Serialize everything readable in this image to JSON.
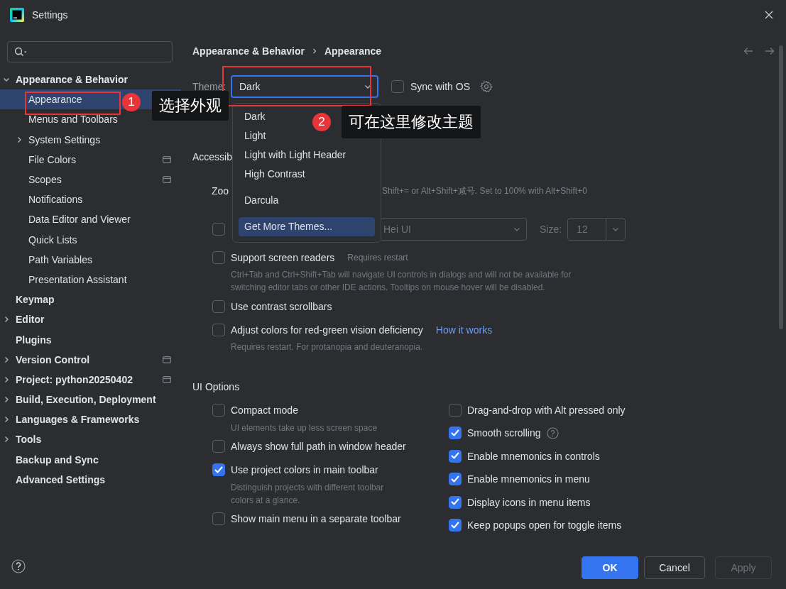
{
  "window": {
    "title": "Settings"
  },
  "sidebar": {
    "items": [
      {
        "label": "Appearance & Behavior",
        "kind": "group",
        "selected": false,
        "expanded": true,
        "project_scoped": false,
        "children": [
          {
            "label": "Appearance",
            "kind": "page",
            "selected": true,
            "project_scoped": false
          },
          {
            "label": "Menus and Toolbars",
            "kind": "page",
            "selected": false,
            "project_scoped": false
          },
          {
            "label": "System Settings",
            "kind": "group",
            "selected": false,
            "expanded": false,
            "project_scoped": false
          },
          {
            "label": "File Colors",
            "kind": "page",
            "selected": false,
            "project_scoped": true
          },
          {
            "label": "Scopes",
            "kind": "page",
            "selected": false,
            "project_scoped": true
          },
          {
            "label": "Notifications",
            "kind": "page",
            "selected": false,
            "project_scoped": false
          },
          {
            "label": "Data Editor and Viewer",
            "kind": "page",
            "selected": false,
            "project_scoped": false
          },
          {
            "label": "Quick Lists",
            "kind": "page",
            "selected": false,
            "project_scoped": false
          },
          {
            "label": "Path Variables",
            "kind": "page",
            "selected": false,
            "project_scoped": false
          },
          {
            "label": "Presentation Assistant",
            "kind": "page",
            "selected": false,
            "project_scoped": false
          }
        ]
      },
      {
        "label": "Keymap",
        "kind": "page",
        "selected": false,
        "project_scoped": false
      },
      {
        "label": "Editor",
        "kind": "group",
        "selected": false,
        "expanded": false,
        "project_scoped": false
      },
      {
        "label": "Plugins",
        "kind": "page",
        "selected": false,
        "project_scoped": false
      },
      {
        "label": "Version Control",
        "kind": "group",
        "selected": false,
        "expanded": false,
        "project_scoped": true
      },
      {
        "label": "Project: python20250402",
        "kind": "group",
        "selected": false,
        "expanded": false,
        "project_scoped": true
      },
      {
        "label": "Build, Execution, Deployment",
        "kind": "group",
        "selected": false,
        "expanded": false,
        "project_scoped": false
      },
      {
        "label": "Languages & Frameworks",
        "kind": "group",
        "selected": false,
        "expanded": false,
        "project_scoped": false
      },
      {
        "label": "Tools",
        "kind": "group",
        "selected": false,
        "expanded": false,
        "project_scoped": false
      },
      {
        "label": "Backup and Sync",
        "kind": "page",
        "selected": false,
        "project_scoped": false
      },
      {
        "label": "Advanced Settings",
        "kind": "page",
        "selected": false,
        "project_scoped": false
      }
    ]
  },
  "breadcrumb": [
    "Appearance & Behavior",
    "Appearance"
  ],
  "theme": {
    "label": "Theme:",
    "value": "Dark",
    "sync": {
      "label": "Sync with OS",
      "checked": false
    }
  },
  "theme_menu": {
    "groups": [
      [
        {
          "label": "Dark",
          "selected": false
        },
        {
          "label": "Light",
          "selected": false
        },
        {
          "label": "Light with Light Header",
          "selected": false
        },
        {
          "label": "High Contrast",
          "selected": false
        }
      ],
      [
        {
          "label": "Darcula",
          "selected": false
        }
      ],
      [
        {
          "label": "Get More Themes...",
          "selected": true
        }
      ]
    ]
  },
  "accessibility": {
    "heading": "Accessib",
    "zoom_label": "Zoo",
    "zoom_hint": "Shift+= or Alt+Shift+减号. Set to 100% with Alt+Shift+0",
    "font": {
      "checked": false,
      "value": "Hei UI",
      "size_label": "Size:",
      "size": "12"
    },
    "options": [
      {
        "label": "Support screen readers",
        "checked": false,
        "note": "Requires restart",
        "description": "Ctrl+Tab and Ctrl+Shift+Tab will navigate UI controls in dialogs and will not be available for switching editor tabs or other IDE actions. Tooltips on mouse hover will be disabled."
      },
      {
        "label": "Use contrast scrollbars",
        "checked": false
      },
      {
        "label": "Adjust colors for red-green vision deficiency",
        "checked": false,
        "link": "How it works",
        "description": "Requires restart. For protanopia and deuteranopia."
      }
    ]
  },
  "ui_options": {
    "heading": "UI Options",
    "left": [
      {
        "label": "Compact mode",
        "checked": false,
        "description": "UI elements take up less screen space"
      },
      {
        "label": "Always show full path in window header",
        "checked": false
      },
      {
        "label": "Use project colors in main toolbar",
        "checked": true,
        "description": "Distinguish projects with different toolbar colors at a glance."
      },
      {
        "label": "Show main menu in a separate toolbar",
        "checked": false
      }
    ],
    "right": [
      {
        "label": "Drag-and-drop with Alt pressed only",
        "checked": false,
        "kind": "plain"
      },
      {
        "label": "Smooth scrolling",
        "checked": true,
        "kind": "with_help"
      },
      {
        "label": "Enable mnemonics in controls",
        "checked": true,
        "kind": "plain"
      },
      {
        "label": "Enable mnemonics in menu",
        "checked": true,
        "kind": "plain"
      },
      {
        "label": "Display icons in menu items",
        "checked": true,
        "kind": "plain"
      },
      {
        "label": "Keep popups open for toggle items",
        "checked": true,
        "kind": "plain"
      }
    ]
  },
  "buttons": [
    {
      "label": "OK",
      "kind": "primary",
      "disabled": false
    },
    {
      "label": "Cancel",
      "kind": "secondary",
      "disabled": false
    },
    {
      "label": "Apply",
      "kind": "secondary",
      "disabled": true
    }
  ],
  "annotations": [
    {
      "number": "1",
      "text": "选择外观"
    },
    {
      "number": "2",
      "text": "可在这里修改主题"
    }
  ]
}
